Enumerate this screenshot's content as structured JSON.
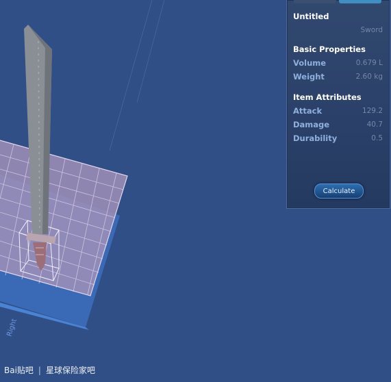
{
  "panel": {
    "title": "Untitled",
    "item_type": "Sword",
    "basic_header": "Basic Properties",
    "basic": [
      {
        "label": "Volume",
        "value": "0.679 L"
      },
      {
        "label": "Weight",
        "value": "2.60 kg"
      }
    ],
    "attr_header": "Item Attributes",
    "attributes": [
      {
        "label": "Attack",
        "value": "129.2"
      },
      {
        "label": "Damage",
        "value": "40.7"
      },
      {
        "label": "Durability",
        "value": "0.5"
      }
    ],
    "calculate_label": "Calculate"
  },
  "scene": {
    "axis_label": "Right",
    "object": "sword-model"
  },
  "watermark": {
    "brand": "Bai贴吧",
    "forum": "星球保险家吧"
  },
  "colors": {
    "background": "#2f4f86",
    "panel": "#2b4268",
    "accent": "#3f8fc4"
  }
}
